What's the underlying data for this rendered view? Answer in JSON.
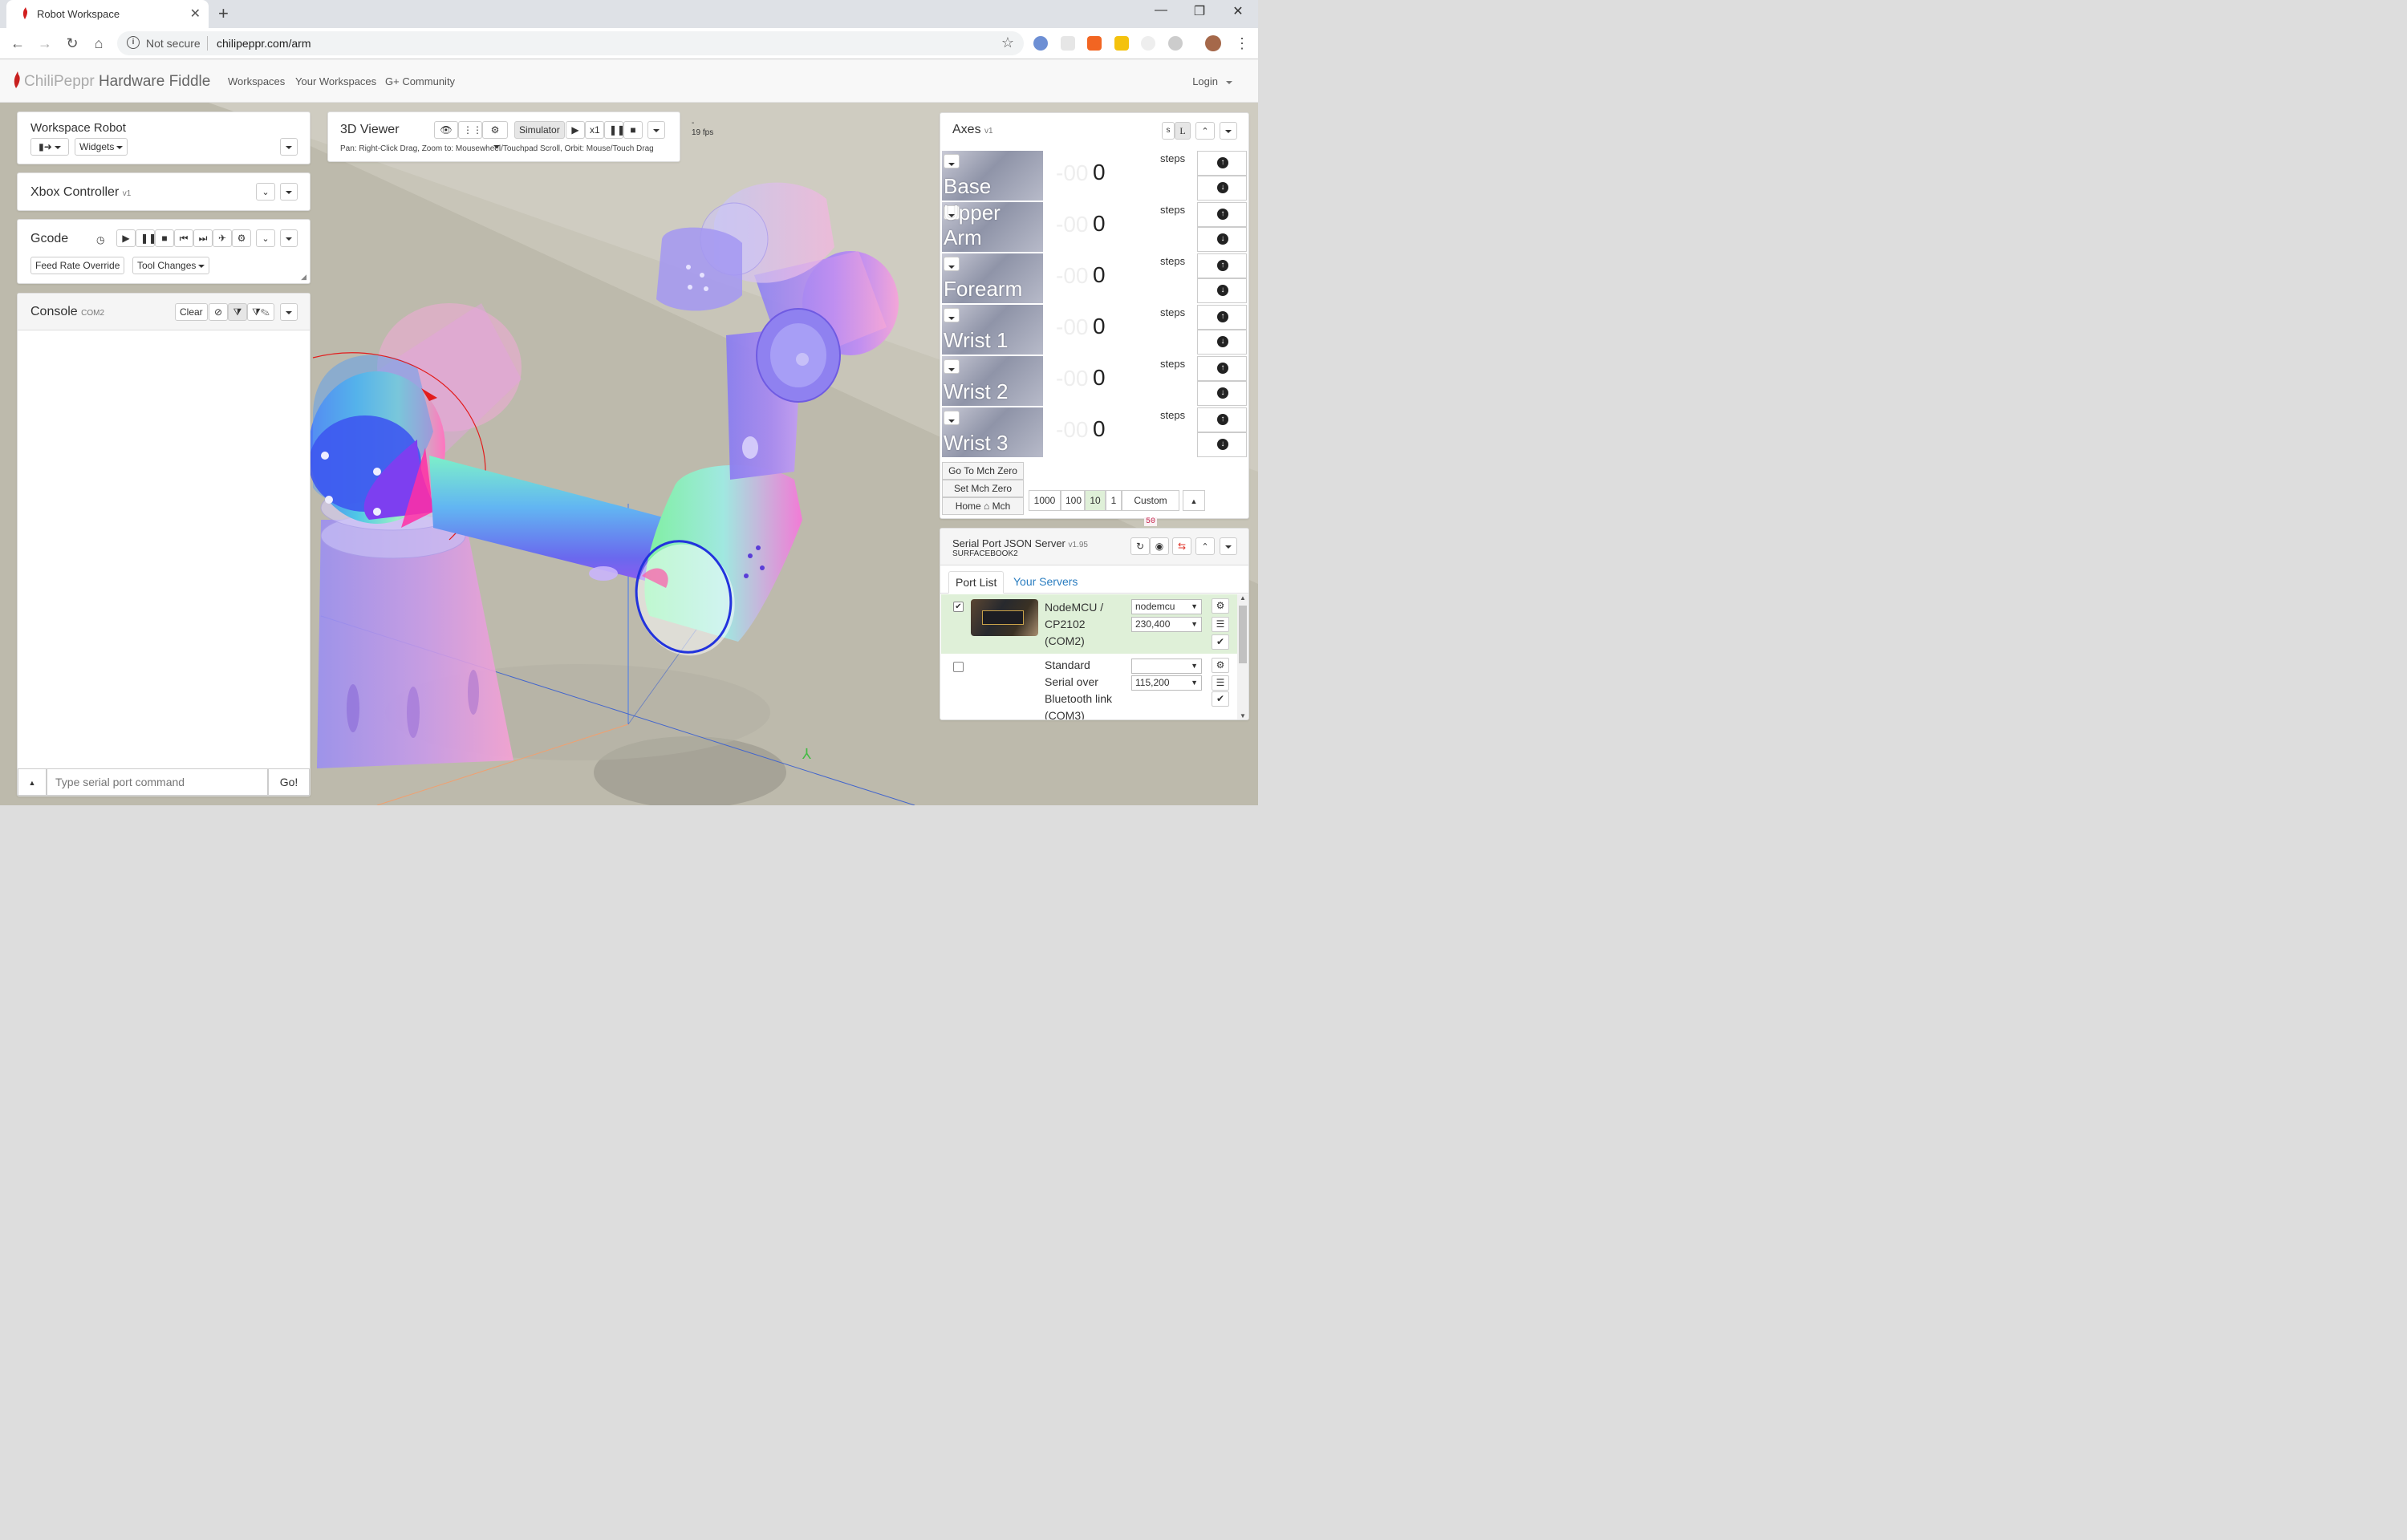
{
  "browser": {
    "tab_title": "Robot Workspace",
    "security_label": "Not secure",
    "url": "chilipeppr.com/arm"
  },
  "app": {
    "brand_light": "ChiliPeppr",
    "brand_dark": "Hardware Fiddle",
    "nav": [
      "Workspaces",
      "Your Workspaces",
      "G+ Community"
    ],
    "login": "Login"
  },
  "workspace_panel": {
    "title": "Workspace Robot",
    "widgets_label": "Widgets"
  },
  "xbox_panel": {
    "title": "Xbox Controller",
    "version": "v1"
  },
  "gcode_panel": {
    "title": "Gcode",
    "feed_rate": "Feed Rate Override",
    "tool_changes": "Tool Changes"
  },
  "console_panel": {
    "title": "Console",
    "port": "COM2",
    "clear_label": "Clear",
    "input_placeholder": "Type serial port command",
    "go_label": "Go!"
  },
  "viewer": {
    "title": "3D Viewer",
    "simulator_label": "Simulator",
    "speed_label": "x1",
    "hint": "Pan: Right-Click Drag, Zoom to: Mousewheel/Touchpad Scroll, Orbit: Mouse/Touch Drag",
    "fps_dash": "-",
    "fps": "19 fps"
  },
  "axes_panel": {
    "title": "Axes",
    "version": "v1",
    "size_s": "s",
    "size_l": "L",
    "axes": [
      {
        "name": "Base",
        "ghost": "-00",
        "value": "0",
        "unit": "steps"
      },
      {
        "name": "Upper Arm",
        "ghost": "-00",
        "value": "0",
        "unit": "steps"
      },
      {
        "name": "Forearm",
        "ghost": "-00",
        "value": "0",
        "unit": "steps"
      },
      {
        "name": "Wrist 1",
        "ghost": "-00",
        "value": "0",
        "unit": "steps"
      },
      {
        "name": "Wrist 2",
        "ghost": "-00",
        "value": "0",
        "unit": "steps"
      },
      {
        "name": "Wrist 3",
        "ghost": "-00",
        "value": "0",
        "unit": "steps"
      }
    ],
    "go_mch_zero": "Go To Mch Zero",
    "set_mch_zero": "Set Mch Zero",
    "home_label": "Home",
    "mch_label": "Mch",
    "steps": [
      "1000",
      "100",
      "10",
      "1"
    ],
    "selected_step": "10",
    "custom_label": "Custom",
    "custom_value": "50"
  },
  "serial_panel": {
    "title": "Serial Port JSON Server",
    "version": "v1.95",
    "host": "SURFACEBOOK2",
    "tab_port_list": "Port List",
    "tab_servers": "Your Servers",
    "ports": [
      {
        "name_lines": [
          "NodeMCU /",
          "CP2102",
          "(COM2)"
        ],
        "buffer": "nodemcu",
        "baud": "230,400",
        "checked": true
      },
      {
        "name_lines": [
          "Standard",
          "Serial over",
          "Bluetooth link",
          "(COM3)"
        ],
        "buffer": "",
        "baud": "115,200",
        "checked": false
      }
    ]
  },
  "colors": {
    "accent_red": "#e0362b",
    "link_blue": "#2a7dc0",
    "selected_row": "#dff0d8",
    "scene_floor": "#c8c5b8"
  }
}
